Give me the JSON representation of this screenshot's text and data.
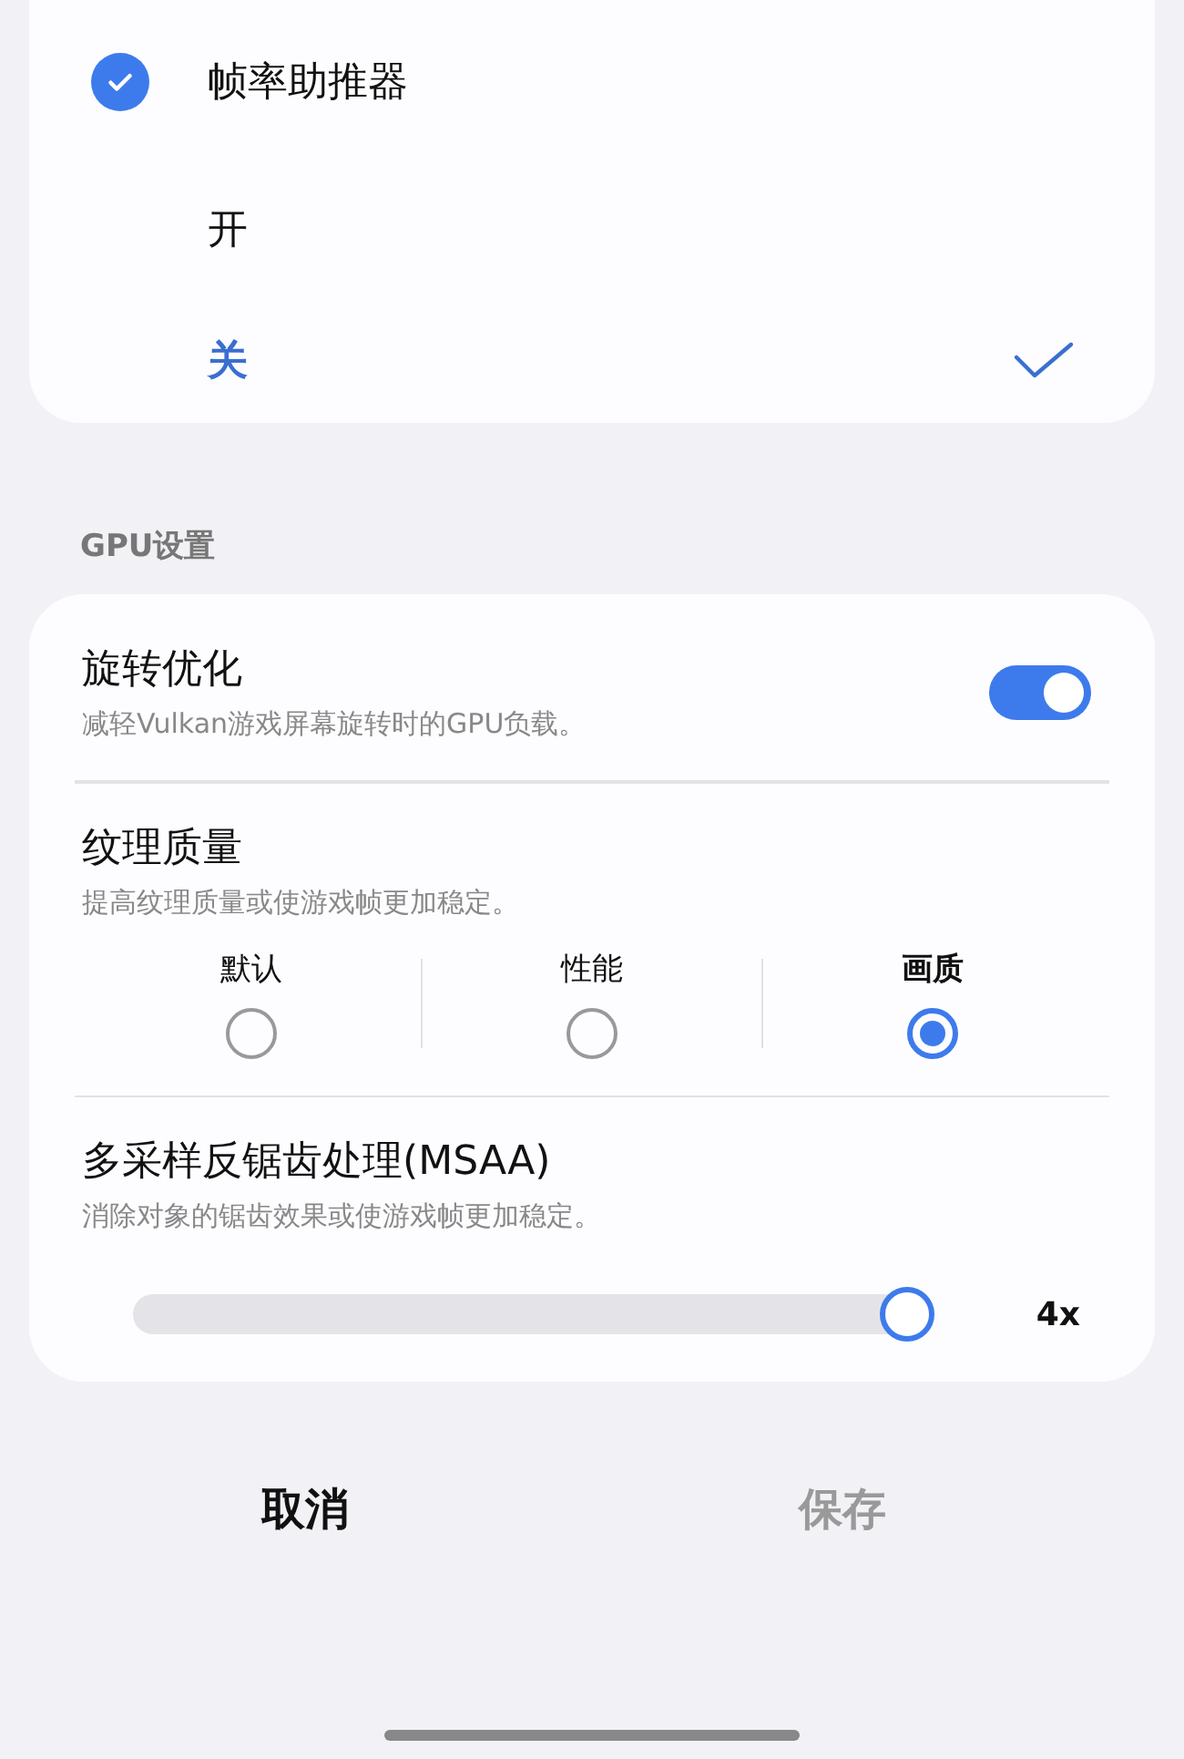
{
  "frame_booster": {
    "title": "帧率助推器",
    "checked": true,
    "options": [
      {
        "label": "开",
        "selected": false
      },
      {
        "label": "关",
        "selected": true
      }
    ]
  },
  "gpu_section": {
    "header": "GPU设置",
    "rotation": {
      "title": "旋转优化",
      "description": "减轻Vulkan游戏屏幕旋转时的GPU负载。",
      "on": true
    },
    "texture": {
      "title": "纹理质量",
      "description": "提高纹理质量或使游戏帧更加稳定。",
      "options": [
        {
          "label": "默认",
          "selected": false
        },
        {
          "label": "性能",
          "selected": false
        },
        {
          "label": "画质",
          "selected": true
        }
      ]
    },
    "msaa": {
      "title": "多采样反锯齿处理(MSAA)",
      "description": "消除对象的锯齿效果或使游戏帧更加稳定。",
      "level": 1,
      "reading": "4x"
    }
  },
  "buttons": [
    {
      "label": "取消",
      "disabled": false
    },
    {
      "label": "保存",
      "disabled": true
    }
  ]
}
